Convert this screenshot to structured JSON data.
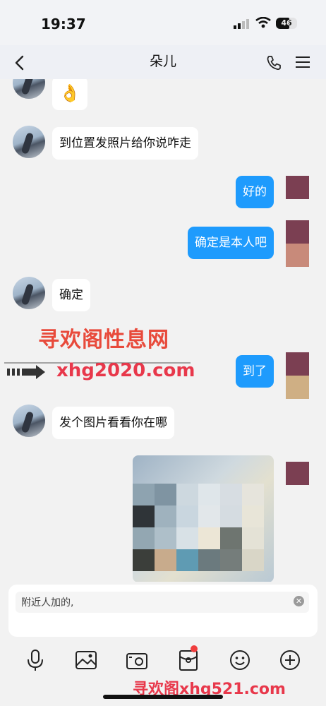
{
  "status": {
    "time": "19:37",
    "battery": "46"
  },
  "header": {
    "title": "朵儿"
  },
  "messages": {
    "m0": "👌",
    "m1": "到位置发照片给你说咋走",
    "m2": "好的",
    "m3": "确定是本人吧",
    "m4": "确定",
    "m5": "到了",
    "m6": "发个图片看看你在哪"
  },
  "watermarks": {
    "w1": "寻欢阁性息网",
    "w2": "xhg2020.com",
    "w3": "寻欢阁xhg521.com"
  },
  "input": {
    "value": "附近人加的,"
  },
  "colors": {
    "outgoing_bubble": "#1e9bfd",
    "incoming_bubble": "#ffffff",
    "notification_dot": "#f03e3e"
  },
  "toolbar": {
    "icons": [
      "microphone-icon",
      "image-icon",
      "camera-icon",
      "red-packet-icon",
      "emoji-icon",
      "plus-icon"
    ]
  }
}
